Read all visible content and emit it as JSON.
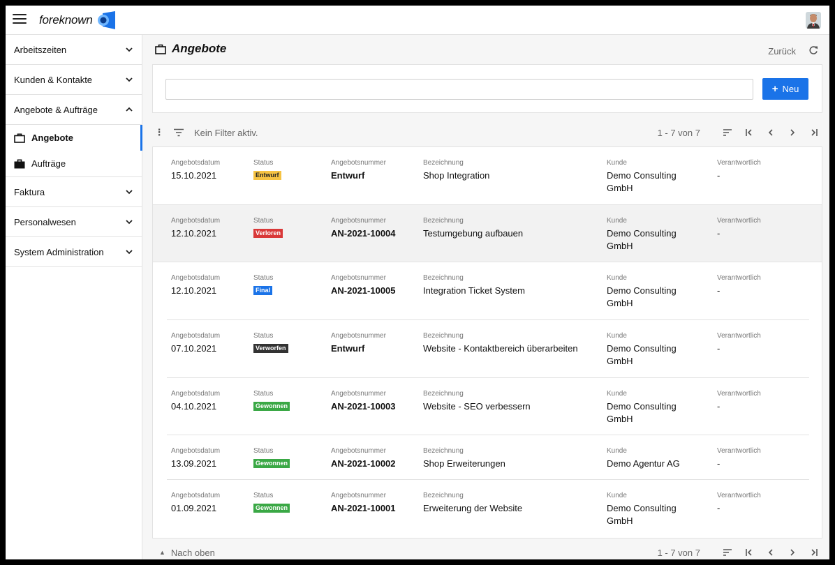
{
  "app": {
    "name": "foreknown"
  },
  "sidebar": {
    "sections": [
      {
        "label": "Arbeitszeiten",
        "expanded": false
      },
      {
        "label": "Kunden & Kontakte",
        "expanded": false
      },
      {
        "label": "Angebote & Aufträge",
        "expanded": true,
        "items": [
          {
            "label": "Angebote",
            "icon": "briefcase-outline-icon",
            "active": true
          },
          {
            "label": "Aufträge",
            "icon": "briefcase-filled-icon",
            "active": false
          }
        ]
      },
      {
        "label": "Faktura",
        "expanded": false
      },
      {
        "label": "Personalwesen",
        "expanded": false
      },
      {
        "label": "System Administration",
        "expanded": false
      }
    ]
  },
  "page": {
    "title": "Angebote",
    "back_label": "Zurück",
    "new_button": "Neu",
    "search_value": "",
    "filter_text": "Kein Filter aktiv.",
    "pagination": "1 - 7 von 7",
    "to_top": "Nach oben"
  },
  "columns": [
    "Angebotsdatum",
    "Status",
    "Angebotsnummer",
    "Bezeichnung",
    "Kunde",
    "Verantwortlich"
  ],
  "colors": {
    "Entwurf": "#f6c343",
    "Verloren": "#d93838",
    "Final": "#1a73e8",
    "Verworfen": "#333333",
    "Gewonnen": "#3aa845",
    "accent": "#1a73e8"
  },
  "offers": [
    {
      "date": "15.10.2021",
      "status": "Entwurf",
      "number": "Entwurf",
      "title": "Shop Integration",
      "customer_l1": "Demo Consulting",
      "customer_l2": "GmbH",
      "owner": "-"
    },
    {
      "date": "12.10.2021",
      "status": "Verloren",
      "number": "AN-2021-10004",
      "title": "Testumgebung aufbauen",
      "customer_l1": "Demo Consulting",
      "customer_l2": "GmbH",
      "owner": "-"
    },
    {
      "date": "12.10.2021",
      "status": "Final",
      "number": "AN-2021-10005",
      "title": "Integration Ticket System",
      "customer_l1": "Demo Consulting",
      "customer_l2": "GmbH",
      "owner": "-"
    },
    {
      "date": "07.10.2021",
      "status": "Verworfen",
      "number": "Entwurf",
      "title": "Website - Kontaktbereich überarbeiten",
      "customer_l1": "Demo Consulting",
      "customer_l2": "GmbH",
      "owner": "-"
    },
    {
      "date": "04.10.2021",
      "status": "Gewonnen",
      "number": "AN-2021-10003",
      "title": "Website - SEO verbessern",
      "customer_l1": "Demo Consulting",
      "customer_l2": "GmbH",
      "owner": "-"
    },
    {
      "date": "13.09.2021",
      "status": "Gewonnen",
      "number": "AN-2021-10002",
      "title": "Shop Erweiterungen",
      "customer_l1": "Demo Agentur AG",
      "customer_l2": "",
      "owner": "-"
    },
    {
      "date": "01.09.2021",
      "status": "Gewonnen",
      "number": "AN-2021-10001",
      "title": "Erweiterung der Website",
      "customer_l1": "Demo Consulting",
      "customer_l2": "GmbH",
      "owner": "-"
    }
  ]
}
